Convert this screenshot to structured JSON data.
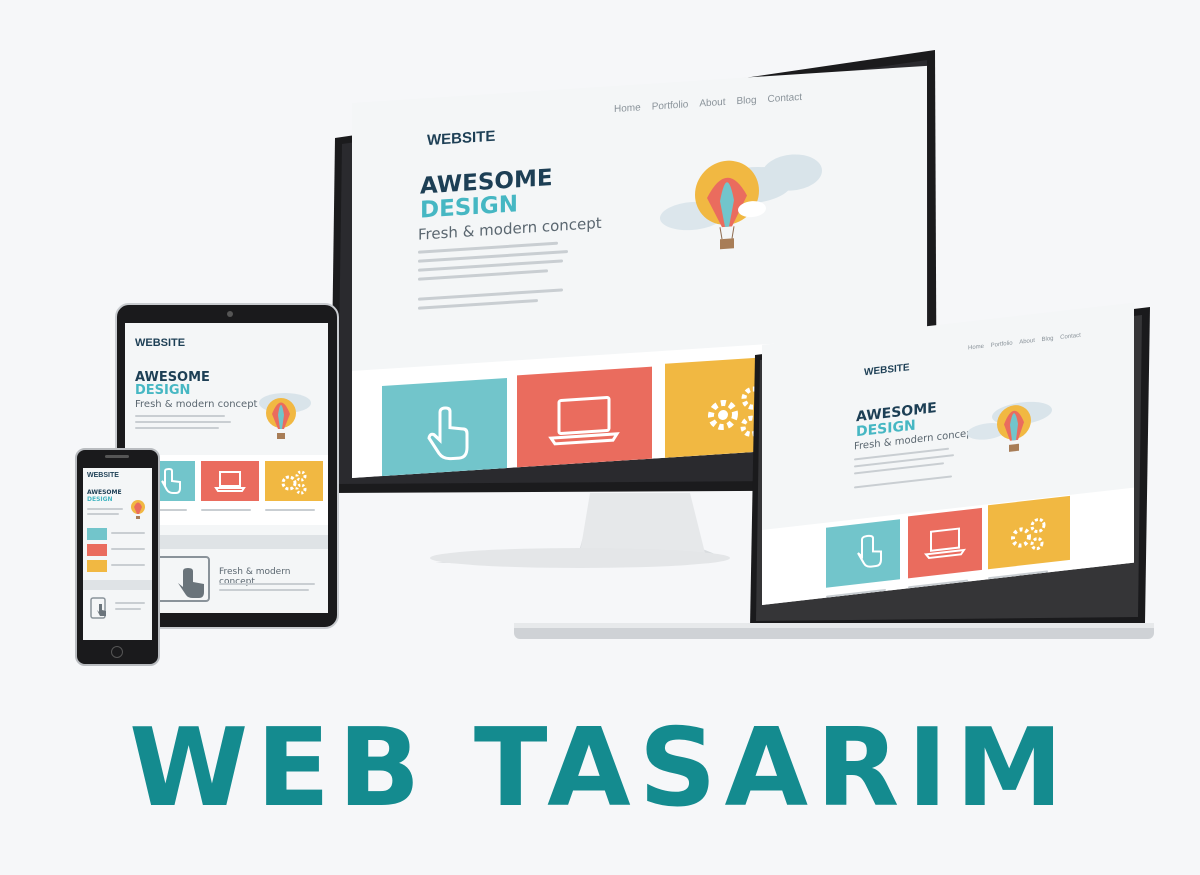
{
  "monitor": {
    "brand": "WEBSITE",
    "nav": [
      "Home",
      "Portfolio",
      "About",
      "Blog",
      "Contact"
    ],
    "headline_line1": "AWESOME",
    "headline_line2": "DESIGN",
    "subhead": "Fresh & modern concept"
  },
  "tablet": {
    "brand": "WEBSITE",
    "headline_line1": "AWESOME",
    "headline_line2": "DESIGN",
    "subhead": "Fresh & modern concept",
    "footer_subhead": "Fresh & modern concept"
  },
  "laptop": {
    "brand": "WEBSITE",
    "nav": [
      "Home",
      "Portfolio",
      "About",
      "Blog",
      "Contact"
    ],
    "headline_line1": "AWESOME",
    "headline_line2": "DESIGN",
    "subhead": "Fresh & modern concept"
  },
  "phone": {
    "brand": "WEBSITE",
    "headline_line1": "AWESOME",
    "headline_line2": "DESIGN"
  },
  "page_title": "WEB TASARIM",
  "colors": {
    "title": "#148b8f",
    "tile_teal": "#72c5cb",
    "tile_red": "#ea6c5e",
    "tile_yellow": "#f1b842",
    "headline_dark": "#1d3f55",
    "headline_accent": "#46b7c3"
  }
}
